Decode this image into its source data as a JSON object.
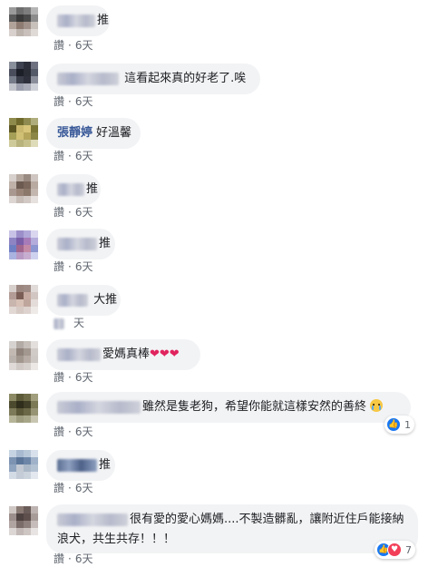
{
  "labels": {
    "like": "讚",
    "sep": "·"
  },
  "comments": [
    {
      "text": "推",
      "time": "6天"
    },
    {
      "text": "這看起來真的好老了.唉",
      "time": "6天"
    },
    {
      "name": "張靜婷",
      "text": "好溫馨",
      "time": "6天"
    },
    {
      "text": "推",
      "time": "6天"
    },
    {
      "text": "推",
      "time": "6天"
    },
    {
      "text": "大推",
      "time": "天"
    },
    {
      "text": "愛媽真棒",
      "hearts": "❤❤❤",
      "time": "6天"
    },
    {
      "text": "雖然是隻老狗，希望你能就這樣安然的善終",
      "emoji": "crying-face",
      "time": "6天",
      "reactions": "1"
    },
    {
      "text": "推",
      "time": "6天"
    },
    {
      "text": "很有愛的愛心媽媽....不製造髒亂，讓附近住戶能接納浪犬，共生共存！！！",
      "time": "6天",
      "reactions": "7"
    }
  ],
  "colors": {
    "link": "#385898",
    "bubble": "#f2f3f5",
    "meta": "#606770",
    "like_blue": "#1877f2",
    "love_red": "#f33e58"
  }
}
